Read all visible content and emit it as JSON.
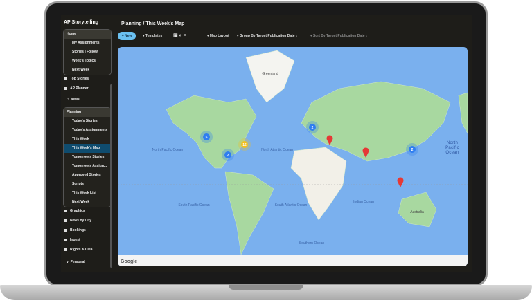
{
  "app": {
    "title": "AP Storytelling"
  },
  "sidebar": {
    "home": {
      "label": "Home",
      "items": [
        "My Assignments",
        "Stories I Follow",
        "Week's Topics",
        "Next Week"
      ]
    },
    "folders1": [
      "Top Stories",
      "AP Planner"
    ],
    "news": "News",
    "planning": {
      "label": "Planning",
      "items": [
        "Today's Stories",
        "Today's Assignments",
        "This Week",
        "This Week's Map",
        "Tomorrow's Stories",
        "Tomorrow's Assign...",
        "Approved Stories",
        "Scripts",
        "This Week List",
        "Next Week"
      ],
      "selected": "This Week's Map"
    },
    "folders2": [
      "Graphics",
      "News by City",
      "Bookings",
      "Ingest",
      "Rights & Clea..."
    ],
    "personal": "Personal"
  },
  "header": {
    "breadcrumb": "Planning / This Week's Map"
  },
  "toolbar": {
    "new": "+ New",
    "templates": "Templates",
    "layout": "Map Layout",
    "group": "Group By Target Publication Date",
    "sort": "Sort By Target Publication Date"
  },
  "map": {
    "labels": {
      "greenland": "Greenland",
      "npo": "North Pacific Ocean",
      "nao": "North Atlantic Ocean",
      "spo": "South Pacific Ocean",
      "sao": "South Atlantic Ocean",
      "io": "Indian Ocean",
      "so": "Southern Ocean",
      "aus": "Australia",
      "npo2": "North Pacific Ocean"
    },
    "clusters": [
      {
        "count": "5",
        "color": "#2f7ef0"
      },
      {
        "count": "2",
        "color": "#2f7ef0"
      },
      {
        "count": "16",
        "color": "#f2c01e"
      },
      {
        "count": "2",
        "color": "#2f7ef0"
      },
      {
        "count": "2",
        "color": "#2f7ef0"
      }
    ],
    "pin_color": "#e53935",
    "attribution": "Google"
  }
}
